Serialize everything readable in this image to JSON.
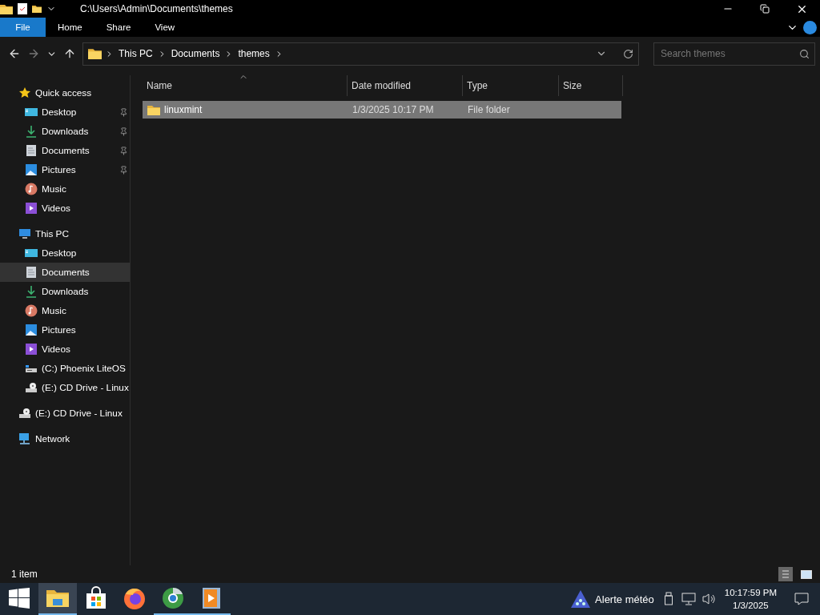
{
  "window": {
    "title": "C:\\Users\\Admin\\Documents\\themes"
  },
  "ribbon": {
    "tabs": [
      {
        "label": "File",
        "selected": true
      },
      {
        "label": "Home",
        "selected": false
      },
      {
        "label": "Share",
        "selected": false
      },
      {
        "label": "View",
        "selected": false
      }
    ]
  },
  "navigation": {
    "back_disabled": false,
    "forward_disabled": true,
    "breadcrumb": [
      "This PC",
      "Documents",
      "themes"
    ],
    "search": {
      "placeholder": "Search themes"
    }
  },
  "sidebar": {
    "items": [
      {
        "label": "Quick access",
        "kind": "star",
        "selected": false,
        "children": [
          {
            "label": "Desktop",
            "kind": "desktop",
            "pinned": true,
            "selected": false
          },
          {
            "label": "Downloads",
            "kind": "downloads",
            "pinned": true,
            "selected": false
          },
          {
            "label": "Documents",
            "kind": "documents",
            "pinned": true,
            "selected": false
          },
          {
            "label": "Pictures",
            "kind": "pictures",
            "pinned": true,
            "selected": false
          },
          {
            "label": "Music",
            "kind": "music",
            "pinned": false,
            "selected": false
          },
          {
            "label": "Videos",
            "kind": "videos",
            "pinned": false,
            "selected": false
          }
        ]
      },
      {
        "label": "This PC",
        "kind": "pc",
        "selected": false,
        "children": [
          {
            "label": "Desktop",
            "kind": "desktop",
            "pinned": false,
            "selected": false
          },
          {
            "label": "Documents",
            "kind": "documents",
            "pinned": false,
            "selected": true
          },
          {
            "label": "Downloads",
            "kind": "downloads",
            "pinned": false,
            "selected": false
          },
          {
            "label": "Music",
            "kind": "music",
            "pinned": false,
            "selected": false
          },
          {
            "label": "Pictures",
            "kind": "pictures",
            "pinned": false,
            "selected": false
          },
          {
            "label": "Videos",
            "kind": "videos",
            "pinned": false,
            "selected": false
          },
          {
            "label": "(C:) Phoenix LiteOS",
            "kind": "drive",
            "pinned": false,
            "selected": false
          },
          {
            "label": "(E:) CD Drive - Linux",
            "kind": "cd",
            "pinned": false,
            "selected": false
          }
        ]
      },
      {
        "label": "(E:) CD Drive - Linux",
        "kind": "cd",
        "selected": false
      },
      {
        "label": "Network",
        "kind": "network",
        "selected": false
      }
    ]
  },
  "table": {
    "columns": [
      {
        "label": "Name",
        "sorted": true
      },
      {
        "label": "Date modified",
        "sorted": false
      },
      {
        "label": "Type",
        "sorted": false
      },
      {
        "label": "Size",
        "sorted": false
      }
    ],
    "rows": [
      {
        "name": "linuxmint",
        "date_modified": "1/3/2025 10:17 PM",
        "type": "File folder",
        "size": "",
        "selected": true
      }
    ]
  },
  "status_bar": {
    "item_count": "1 item",
    "views": [
      {
        "kind": "details",
        "selected": true
      },
      {
        "kind": "large_icons",
        "selected": false
      }
    ]
  },
  "taskbar": {
    "apps": [
      {
        "kind": "explorer",
        "selected": true,
        "running": true
      },
      {
        "kind": "store",
        "selected": false,
        "running": false
      },
      {
        "kind": "firefox",
        "selected": false,
        "running": false
      },
      {
        "kind": "browser",
        "selected": false,
        "running": true
      },
      {
        "kind": "media",
        "selected": false,
        "running": true
      }
    ],
    "weather": "Alerte météo",
    "time": "10:17:59 PM",
    "date": "1/3/2025"
  }
}
